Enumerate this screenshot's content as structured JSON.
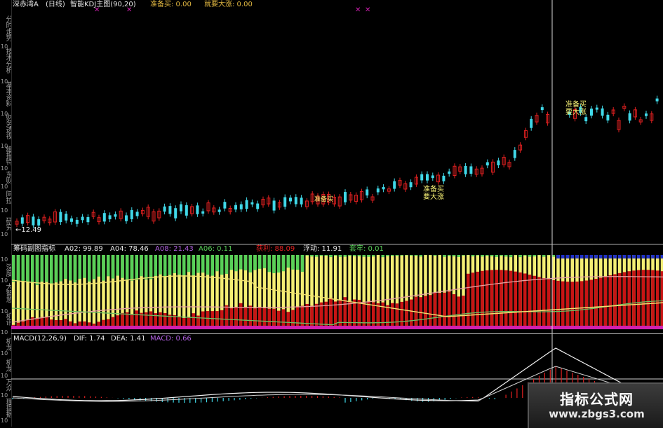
{
  "header": {
    "stock_name": "深赤湾A",
    "period": "(日线)",
    "indicator": "智能KDJ主图(90,20)",
    "prepare_buy": "准备买: 0.00",
    "surge": "就要大涨: 0.00"
  },
  "sidebar": {
    "items": [
      "分时走势",
      "技术分析",
      "基本资料",
      "财务透视",
      "细报特",
      "东财",
      "阿拉",
      "研究",
      "深度",
      "大智慧",
      "机讯",
      "机龙",
      "机龙",
      "万众",
      "理提据"
    ]
  },
  "main_chart": {
    "price_label": "12.49",
    "annotation_1": "准备买 要大涨",
    "annotation_2": "准备买 要大涨",
    "annotation_small": "准备买"
  },
  "chip_panel": {
    "title": "筹码副图指标",
    "a02": "A02: 99.89",
    "a04": "A04: 78.46",
    "a08": "A08: 21.43",
    "a06": "A06: 0.11",
    "profit": "获利: 88.09",
    "float": "浮动: 11.91",
    "trapped": "套牢: 0.01"
  },
  "macd_panel": {
    "title": "MACD(12,26,9)",
    "dif": "DIF: 1.74",
    "dea": "DEA: 1.41",
    "macd": "MACD: 0.66"
  },
  "watermark": {
    "title": "指标公式网",
    "url": "www.zbgs3.com"
  },
  "colors": {
    "header_gold": "#e0b640",
    "header_white": "#e6e6e6",
    "up_red": "#e02020",
    "down_cyan": "#40d8e8",
    "chip_red": "#c81414",
    "chip_yellow": "#f4ee74",
    "chip_green": "#58d058",
    "magenta": "#d020b0",
    "blue_bar": "#2030c8"
  }
}
